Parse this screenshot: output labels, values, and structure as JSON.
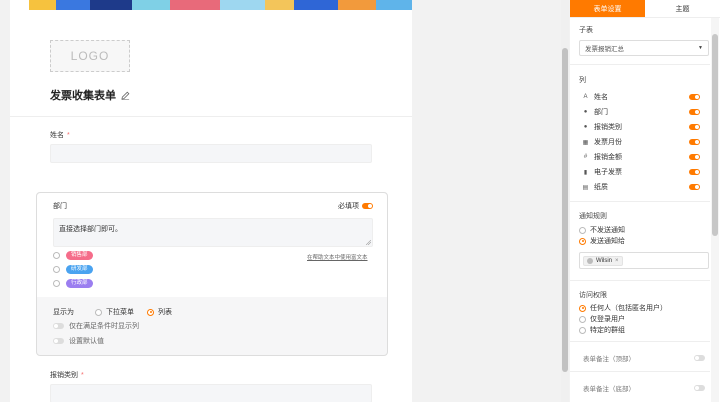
{
  "form": {
    "logo_text": "LOGO",
    "title": "发票收集表单",
    "fields": {
      "name_label": "姓名",
      "name_required": "*",
      "dept_label": "部门",
      "dept_required_label": "必填项",
      "dept_desc": "直接选择部门即可。",
      "dept_desc_hint": "在帮助文本中使用富文本",
      "dept_options": [
        {
          "label": "销售部",
          "color": "#f56c8a"
        },
        {
          "label": "研发部",
          "color": "#4aa3f0"
        },
        {
          "label": "行政部",
          "color": "#9b7ef0"
        }
      ],
      "display_label": "显示为",
      "display_options": [
        "下拉菜单",
        "列表"
      ],
      "display_selected": "列表",
      "conditional_label": "仅在满足条件时显示列",
      "default_label": "设置默认值",
      "expense_label": "报销类别",
      "expense_required": "*"
    }
  },
  "panel": {
    "tabs": [
      "表单设置",
      "主题"
    ],
    "active_tab": "表单设置",
    "subtable_label": "子表",
    "subtable_value": "发票报销汇总",
    "columns_label": "列",
    "columns": [
      {
        "icon": "text-icon",
        "glyph": "A",
        "label": "姓名",
        "enabled": true
      },
      {
        "icon": "dept-icon",
        "glyph": "●",
        "label": "部门",
        "enabled": true
      },
      {
        "icon": "select-icon",
        "glyph": "●",
        "label": "报销类别",
        "enabled": true
      },
      {
        "icon": "calendar-icon",
        "glyph": "▦",
        "label": "发票月份",
        "enabled": true
      },
      {
        "icon": "number-icon",
        "glyph": "#",
        "label": "报销金额",
        "enabled": true
      },
      {
        "icon": "file-icon",
        "glyph": "▮",
        "label": "电子发票",
        "enabled": true
      },
      {
        "icon": "image-icon",
        "glyph": "▤",
        "label": "纸质",
        "enabled": true
      }
    ],
    "notify_label": "通知规则",
    "notify_options": [
      "不发送通知",
      "发送通知给"
    ],
    "notify_selected": "发送通知给",
    "notify_user": "Wilsin",
    "access_label": "访问权限",
    "access_options": [
      "任何人（包括匿名用户）",
      "仅登录用户",
      "特定的群组"
    ],
    "access_selected": "任何人（包括匿名用户）",
    "note_top": "表单备注（顶部）",
    "note_bottom": "表单备注（底部）"
  },
  "colors": {
    "accent": "#ff7a00",
    "required": "#f56c6c"
  }
}
